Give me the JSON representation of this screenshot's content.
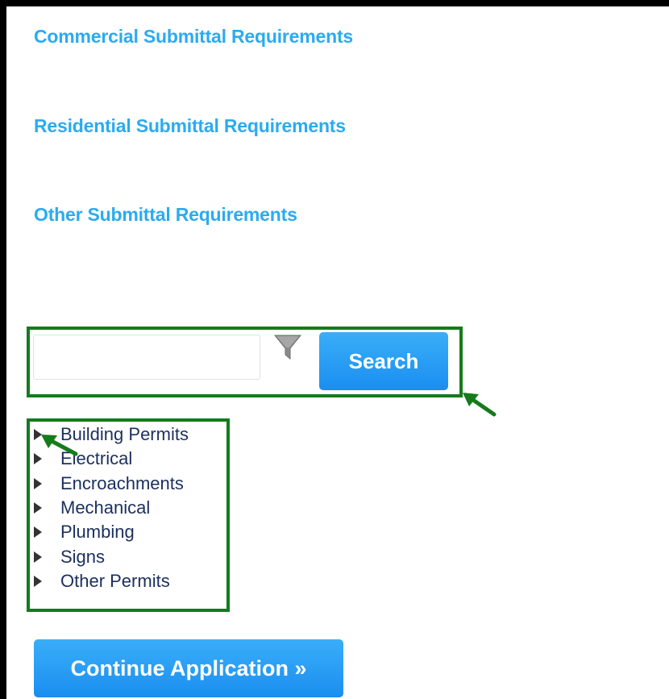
{
  "requirements": {
    "commercial": "Commercial Submittal Requirements",
    "residential": "Residential Submittal Requirements",
    "other": "Other Submittal Requirements"
  },
  "search": {
    "value": "",
    "placeholder": "",
    "button_label": "Search"
  },
  "icons": {
    "filter": "filter-icon",
    "tree_toggle": "triangle-right-icon",
    "annotation_arrow": "green-arrow-icon"
  },
  "tree": {
    "items": [
      {
        "label": "Building Permits"
      },
      {
        "label": "Electrical"
      },
      {
        "label": "Encroachments"
      },
      {
        "label": "Mechanical"
      },
      {
        "label": "Plumbing"
      },
      {
        "label": "Signs"
      },
      {
        "label": "Other Permits"
      }
    ]
  },
  "continue": {
    "label": "Continue Application »"
  },
  "colors": {
    "link": "#2aabf0",
    "button": "#1a8ef0",
    "highlight": "#137c1b",
    "tree_text": "#1b2f5e"
  }
}
